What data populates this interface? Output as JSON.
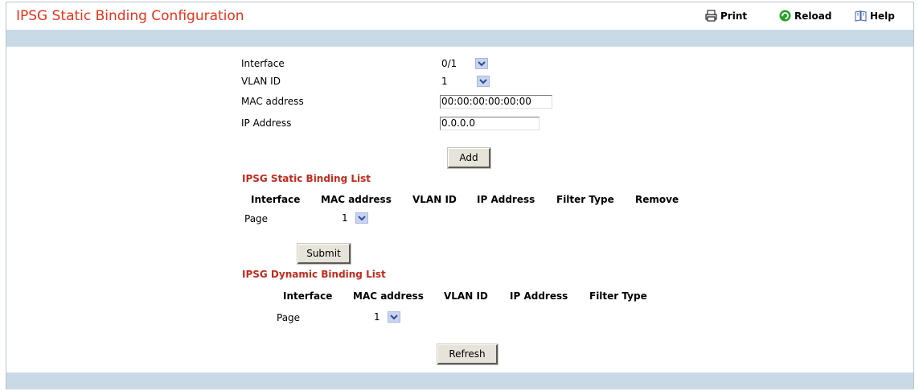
{
  "page": {
    "title": "IPSG Static Binding Configuration",
    "toolbar": {
      "print": "Print",
      "reload": "Reload",
      "help": "Help"
    }
  },
  "form": {
    "interface_label": "Interface",
    "interface_value": "0/1",
    "vlan_label": "VLAN ID",
    "vlan_value": "1",
    "mac_label": "MAC address",
    "mac_value": "00:00:00:00:00:00",
    "ip_label": "IP Address",
    "ip_value": "0.0.0.0",
    "add_button": "Add"
  },
  "static_list": {
    "title": "IPSG Static Binding List",
    "columns": [
      "Interface",
      "MAC address",
      "VLAN ID",
      "IP Address",
      "Filter Type",
      "Remove"
    ],
    "page_label": "Page",
    "page_value": "1",
    "submit_button": "Submit"
  },
  "dynamic_list": {
    "title": "IPSG Dynamic Binding List",
    "columns": [
      "Interface",
      "MAC address",
      "VLAN ID",
      "IP Address",
      "Filter Type"
    ],
    "page_label": "Page",
    "page_value": "1",
    "refresh_button": "Refresh"
  },
  "colors": {
    "title": "#e8321c",
    "section": "#c22b1e",
    "bar": "#c9d9e6"
  },
  "icons": {
    "print": "printer-icon",
    "reload": "reload-icon",
    "help": "help-book-icon"
  }
}
